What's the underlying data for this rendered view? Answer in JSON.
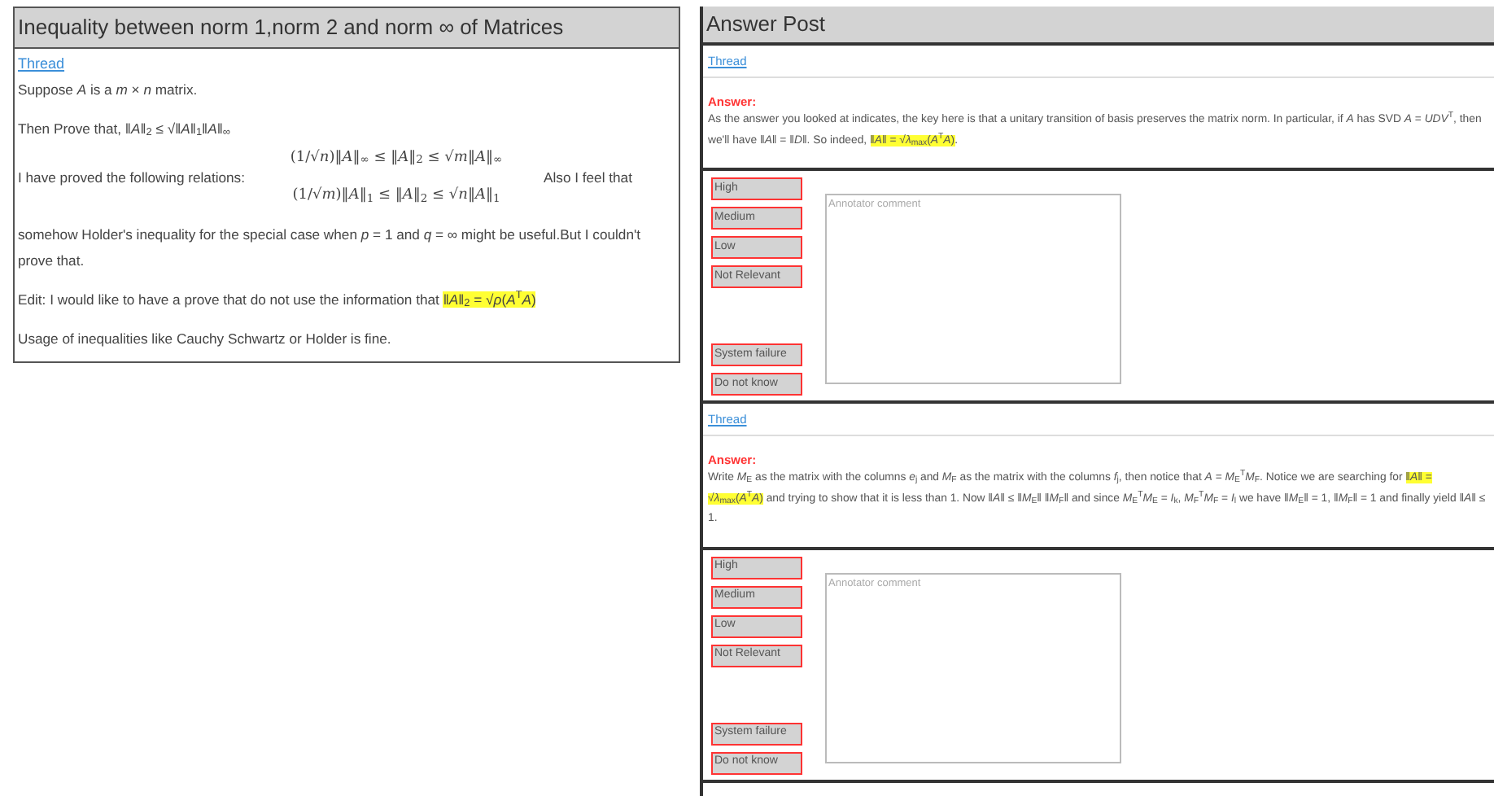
{
  "question": {
    "title": "Inequality between norm 1,norm 2 and norm ∞ of Matrices",
    "link": "Thread",
    "paragraphs": [
      {
        "kind": "text",
        "segments": [
          {
            "text": "Suppose *A* is a *m* × *n* matrix.",
            "highlighted": false
          }
        ]
      },
      {
        "kind": "text",
        "segments": [
          {
            "text": "Then Prove that, ‖*A*‖$_{2}$ ≤ √‖*A*‖$_{1}$‖*A*‖$_{∞}$",
            "highlighted": false
          }
        ]
      },
      {
        "kind": "relations",
        "lead": "I have proved the following relations:",
        "lines": [
          "(1/√*n*)‖*A*‖$_{∞}$ ≤ ‖*A*‖$_{2}$ ≤ √*m*‖*A*‖$_{∞}$",
          "(1/√*m*)‖*A*‖$_{1}$ ≤ ‖*A*‖$_{2}$ ≤ √*n*‖*A*‖$_{1}$"
        ],
        "tail": "Also I feel that"
      },
      {
        "kind": "text",
        "segments": [
          {
            "text": "somehow Holder's inequality for the special case when *p* = 1 and *q* = ∞ might be useful.But I couldn't prove that.",
            "highlighted": false
          }
        ]
      },
      {
        "kind": "text",
        "segments": [
          {
            "text": "Edit: I would like to have a prove that do not use the information that ",
            "highlighted": false
          },
          {
            "text": "‖*A*‖$_{2}$ = √*ρ*(*A*$^{T}$*A*)",
            "highlighted": true
          }
        ]
      },
      {
        "kind": "text",
        "segments": [
          {
            "text": "Usage of inequalities like Cauchy Schwartz or Holder is fine.",
            "highlighted": false
          }
        ]
      }
    ]
  },
  "answer_post": {
    "title": "Answer Post",
    "answers": [
      {
        "link": "Thread",
        "label": "Answer:",
        "segments": [
          {
            "text": "As the answer you looked at indicates, the key here is that a unitary transition of basis preserves the matrix norm. In particular, if *A* has SVD *A* = *UDV*$^{T}$, then we'll have ‖*A*‖ = ‖*D*‖. So indeed, ",
            "highlighted": false
          },
          {
            "text": "‖*A*‖ = √*λ*$_{max}$(*A*$^{T}$*A*)",
            "highlighted": true
          },
          {
            "text": ".",
            "highlighted": false
          }
        ],
        "ratings": [
          {
            "label": "High",
            "kind": "level"
          },
          {
            "label": "Medium",
            "kind": "level"
          },
          {
            "label": "Low",
            "kind": "level"
          },
          {
            "label": "Not Relevant",
            "kind": "level"
          },
          {
            "label": "System failure",
            "kind": "flag"
          },
          {
            "label": "Do not know",
            "kind": "flag"
          }
        ],
        "comment_placeholder": "Annotator comment"
      },
      {
        "link": "Thread",
        "label": "Answer:",
        "segments": [
          {
            "text": "Write *M*$_{E}$ as the matrix with the columns *e*$_{j}$ and *M*$_{F}$ as the matrix with the columns *f*$_{j}$, then notice that *A* = *M*$_{E}$$^{T}$*M*$_{F}$. Notice we are searching for ",
            "highlighted": false
          },
          {
            "text": "‖*A*‖ = √*λ*$_{max}$(*A*$^{T}$*A*)",
            "highlighted": true
          },
          {
            "text": " and trying to show that it is less than 1. Now ‖*A*‖ ≤ ‖*M*$_{E}$‖ ‖*M*$_{F}$‖ and since *M*$_{E}$$^{T}$*M*$_{E}$ = *I*$_{k}$, *M*$_{F}$$^{T}$*M*$_{F}$ = *I*$_{l}$ we have ‖*M*$_{E}$‖ = 1, ‖*M*$_{F}$‖ = 1 and finally yield ‖*A*‖ ≤ 1.",
            "highlighted": false
          }
        ],
        "ratings": [
          {
            "label": "High",
            "kind": "level"
          },
          {
            "label": "Medium",
            "kind": "level"
          },
          {
            "label": "Low",
            "kind": "level"
          },
          {
            "label": "Not Relevant",
            "kind": "level"
          },
          {
            "label": "System failure",
            "kind": "flag"
          },
          {
            "label": "Do not know",
            "kind": "flag"
          }
        ],
        "comment_placeholder": "Annotator comment"
      }
    ]
  }
}
